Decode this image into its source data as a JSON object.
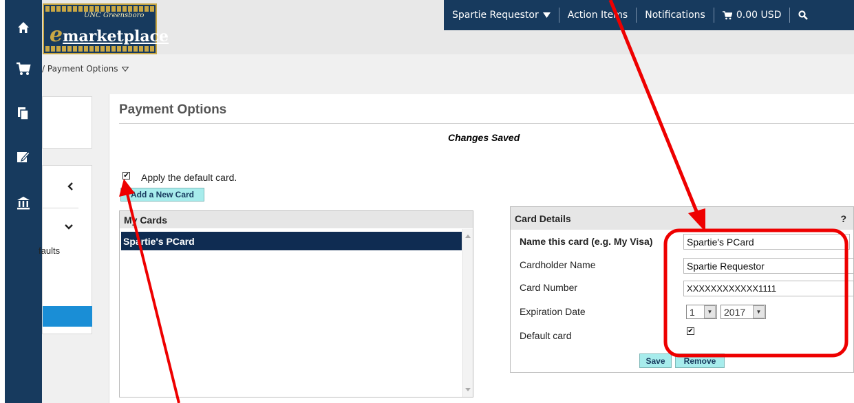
{
  "logo": {
    "sub": "UNC Greensboro",
    "main_e": "e",
    "main_rest": "marketplace"
  },
  "topnav": {
    "user": "Spartie Requestor",
    "action_items": "Action Items",
    "notifications": "Notifications",
    "cart_total": "0.00 USD"
  },
  "breadcrumb": {
    "sep": "/",
    "current": "Payment Options"
  },
  "sidebar": {
    "defaults_text": "faults"
  },
  "page": {
    "title": "Payment Options",
    "status": "Changes Saved"
  },
  "default_card_checkbox": {
    "label": "Apply the default card.",
    "checked": true
  },
  "add_card_label": "Add a New Card",
  "my_cards": {
    "header": "My Cards",
    "items": [
      "Spartie's PCard"
    ],
    "selected": 0
  },
  "card_details": {
    "header": "Card Details",
    "help": "?",
    "name_label": "Name this card (e.g. My Visa)",
    "name_value": "Spartie's PCard",
    "holder_label": "Cardholder Name",
    "holder_value": "Spartie Requestor",
    "number_label": "Card Number",
    "number_value": "XXXXXXXXXXXX1111",
    "exp_label": "Expiration Date",
    "exp_month": "1",
    "exp_year": "2017",
    "default_label": "Default card",
    "default_checked": true,
    "save_label": "Save",
    "remove_label": "Remove"
  },
  "colors": {
    "nav": "#173a5e",
    "accent_button": "#a7ecec",
    "selected_row": "#0f2c52",
    "annotation": "#ee0000"
  }
}
